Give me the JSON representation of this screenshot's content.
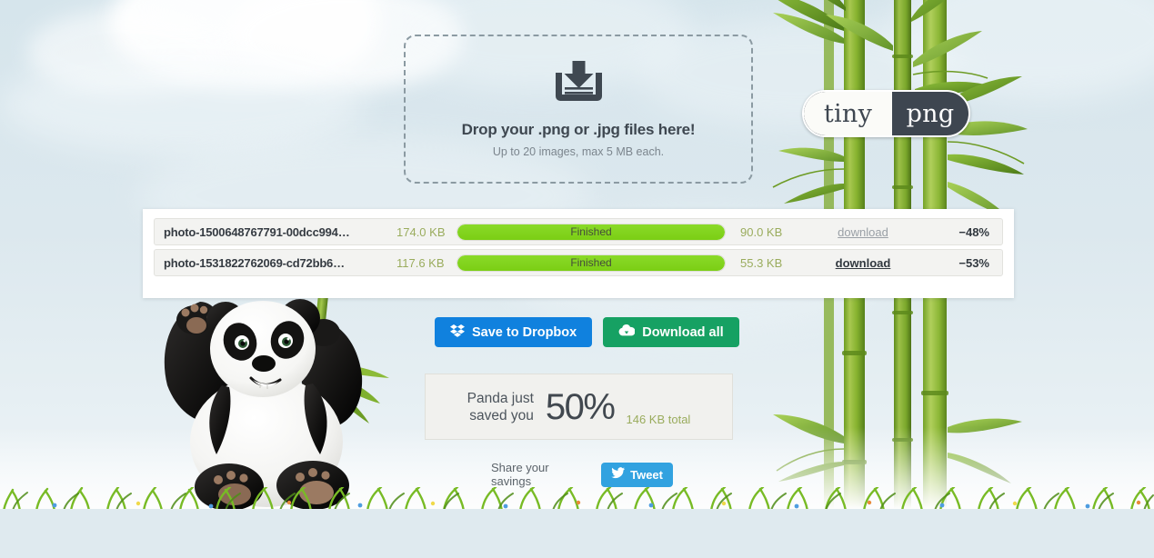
{
  "colors": {
    "sky": "#dce8ee",
    "accent_green": "#7bce14",
    "size_text": "#9aac5d",
    "dropbox_blue": "#1081de",
    "download_green": "#16a163",
    "tweet_blue": "#32a2e0",
    "logo_dark": "#3e4650",
    "text_dark": "#353b42"
  },
  "logo": {
    "left_word": "tiny",
    "right_word": "png",
    "icon": "tinypng-logo"
  },
  "dropzone": {
    "icon": "download-tray-icon",
    "title": "Drop your .png or .jpg files here!",
    "subtitle": "Up to 20 images, max 5 MB each."
  },
  "files": {
    "columns": [
      "filename",
      "original_size",
      "status",
      "compressed_size",
      "download",
      "savings"
    ],
    "rows": [
      {
        "filename": "photo-1500648767791-00dcc994…",
        "original_size": "174.0 KB",
        "status": "Finished",
        "progress": 100,
        "compressed_size": "90.0 KB",
        "download_label": "download",
        "download_state": "dim",
        "savings": "−48%"
      },
      {
        "filename": "photo-1531822762069-cd72bb6…",
        "original_size": "117.6 KB",
        "status": "Finished",
        "progress": 100,
        "compressed_size": "55.3 KB",
        "download_label": "download",
        "download_state": "strong",
        "savings": "−53%"
      }
    ]
  },
  "actions": {
    "dropbox": {
      "label": "Save to Dropbox",
      "icon": "dropbox-icon"
    },
    "download_all": {
      "label": "Download all",
      "icon": "cloud-download-icon"
    }
  },
  "savings": {
    "line1": "Panda just",
    "line2": "saved you",
    "percent": "50%",
    "total": "146 KB total"
  },
  "share": {
    "label": "Share your savings",
    "tweet_label": "Tweet",
    "tweet_icon": "twitter-bird-icon"
  },
  "decor": {
    "panda": "panda-mascot-illustration",
    "bamboo": "bamboo-stalks-illustration",
    "grass": "grass-strip-illustration",
    "clouds": "cloud-illustration"
  }
}
